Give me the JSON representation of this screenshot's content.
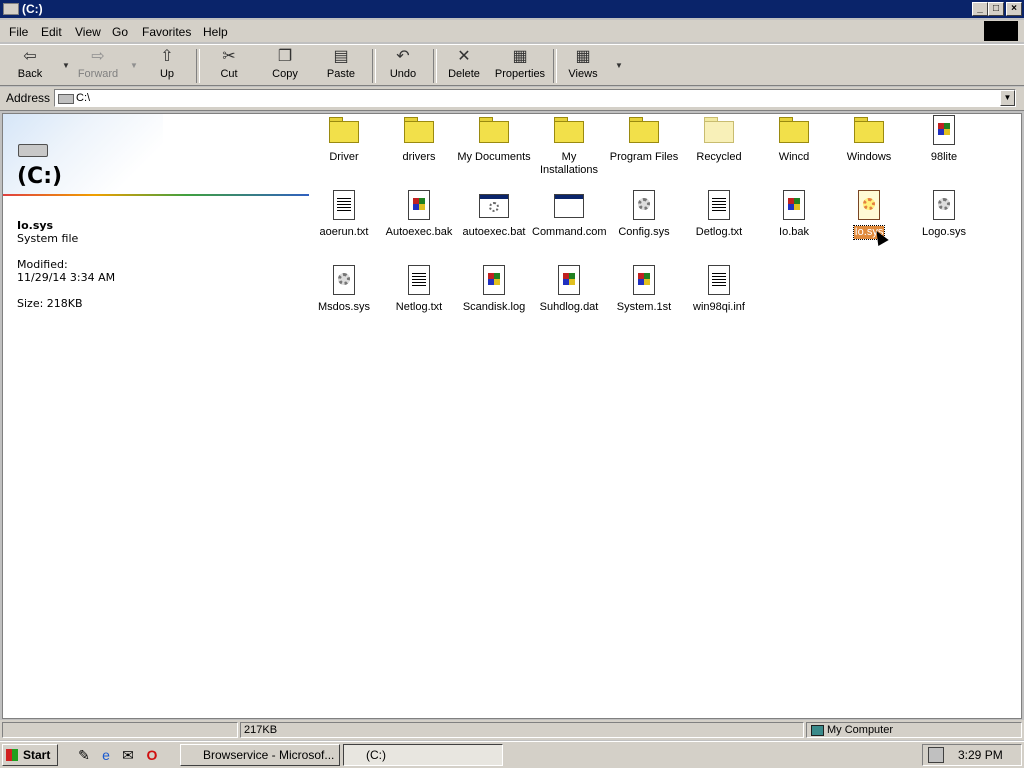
{
  "window": {
    "title": "(C:)",
    "caption_buttons": [
      "_",
      "□",
      "×"
    ]
  },
  "menu": [
    "File",
    "Edit",
    "View",
    "Go",
    "Favorites",
    "Help"
  ],
  "toolbar": {
    "back": "Back",
    "forward": "Forward",
    "up": "Up",
    "cut": "Cut",
    "copy": "Copy",
    "paste": "Paste",
    "undo": "Undo",
    "delete": "Delete",
    "properties": "Properties",
    "views": "Views"
  },
  "address": {
    "label": "Address",
    "value": "C:\\"
  },
  "panel": {
    "title": "(C:)",
    "file_name": "Io.sys",
    "file_type": "System file",
    "modified_label": "Modified:",
    "modified_value": "11/29/14 3:34 AM",
    "size": "Size: 218KB"
  },
  "items": [
    {
      "name": "Driver",
      "kind": "folder"
    },
    {
      "name": "drivers",
      "kind": "folder"
    },
    {
      "name": "My Documents",
      "kind": "folder"
    },
    {
      "name": "My Installations",
      "kind": "folder"
    },
    {
      "name": "Program Files",
      "kind": "folder"
    },
    {
      "name": "Recycled",
      "kind": "folder-faded"
    },
    {
      "name": "Wincd",
      "kind": "folder"
    },
    {
      "name": "Windows",
      "kind": "folder"
    },
    {
      "name": "98lite",
      "kind": "win"
    },
    {
      "name": "aoerun.txt",
      "kind": "txt"
    },
    {
      "name": "Autoexec.bak",
      "kind": "win"
    },
    {
      "name": "autoexec.bat",
      "kind": "app"
    },
    {
      "name": "Command.com",
      "kind": "app-blank"
    },
    {
      "name": "Config.sys",
      "kind": "gear"
    },
    {
      "name": "Detlog.txt",
      "kind": "txt"
    },
    {
      "name": "Io.bak",
      "kind": "win"
    },
    {
      "name": "Io.sys",
      "kind": "gear",
      "selected": true
    },
    {
      "name": "Logo.sys",
      "kind": "gear"
    },
    {
      "name": "Msdos.sys",
      "kind": "gear"
    },
    {
      "name": "Netlog.txt",
      "kind": "txt"
    },
    {
      "name": "Scandisk.log",
      "kind": "win"
    },
    {
      "name": "Suhdlog.dat",
      "kind": "win"
    },
    {
      "name": "System.1st",
      "kind": "win"
    },
    {
      "name": "win98qi.inf",
      "kind": "txt"
    }
  ],
  "status": {
    "size": "217KB",
    "zone": "My Computer"
  },
  "taskbar": {
    "start": "Start",
    "tasks": [
      {
        "label": "Browservice - Microsof...",
        "active": false
      },
      {
        "label": "(C:)",
        "active": true
      }
    ],
    "clock": "3:29 PM"
  }
}
